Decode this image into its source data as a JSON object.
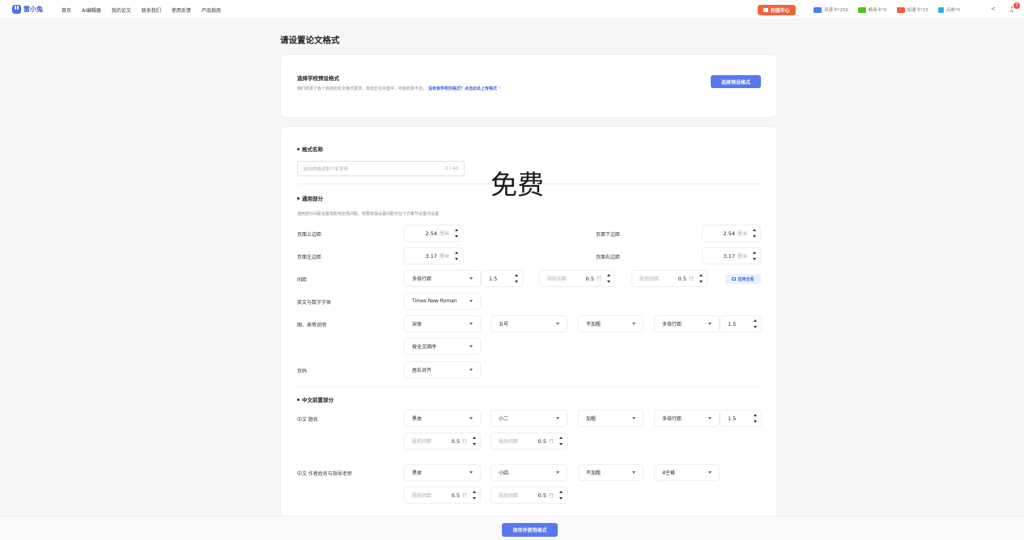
{
  "header": {
    "logo_text": "雷小兔",
    "nav": [
      "首页",
      "AI编辑器",
      "我的论文",
      "联系我们",
      "使用反馈",
      "产品指南"
    ],
    "recharge_label": "充值中心",
    "cards": [
      {
        "label": "灵感卡*259",
        "color": "#4a7cf7"
      },
      {
        "label": "畅用卡*0",
        "color": "#52c41a"
      },
      {
        "label": "加速卡*23",
        "color": "#f25a3a"
      },
      {
        "label": "点券*0",
        "color": "#1fb8d6"
      }
    ],
    "notification_count": "3"
  },
  "page_title": "请设置论文格式",
  "preset": {
    "title": "选择学校预设格式",
    "desc": "我们收录了各个高校的论文格式要求，目前正在完善中，可能收录不全。",
    "link": "没有我学校的格式？点击此处上传格式",
    "button": "选择预设格式"
  },
  "form": {
    "name_section": "格式名称",
    "name_placeholder": "给你的格式取个名字吧",
    "name_count": "0 / 40",
    "watermark": "免费",
    "general_section": "通用部分",
    "general_note": "通用部分间距设置将影响全局间距。想要单独设置间距可在下方章节设置内设置",
    "labels": {
      "top_margin": "页面上边距",
      "bottom_margin": "页面下边距",
      "left_margin": "页面左边距",
      "right_margin": "页面右边距",
      "spacing": "间距",
      "en_font": "英文与数字字体",
      "caption": "图、表等说明",
      "page_num": "页码",
      "cn_title": "中文 题名",
      "cn_author": "中文 作者姓名与指导老师"
    },
    "units": {
      "cm": "厘米",
      "line": "行",
      "before": "段前间距",
      "after": "段后间距"
    },
    "values": {
      "top": "2.54",
      "bottom": "2.54",
      "left": "3.17",
      "right": "3.17",
      "line_mode": "多倍行距",
      "line_value": "1.5",
      "before": "0.5",
      "after": "0.5",
      "apply_all": "应用全局",
      "en_font": "Times New Roman",
      "cap_font": "宋体",
      "cap_size": "五号",
      "cap_weight": "不加粗",
      "cap_line_mode": "多倍行距",
      "cap_line_value": "1.5",
      "cap_order": "按全文顺序",
      "page_align": "居右对齐",
      "title_font": "黑体",
      "title_size": "小二",
      "title_weight": "加粗",
      "title_line_mode": "多倍行距",
      "title_line_value": "1.5",
      "title_before": "0.5",
      "title_after": "0.5",
      "author_font": "黑体",
      "author_size": "小四",
      "author_weight": "不加粗",
      "author_indent": "4空格",
      "author_before": "0.5",
      "author_after": "0.5"
    },
    "cn_front_section": "中文前置部分"
  },
  "footer": {
    "save_button": "保存并使用格式"
  }
}
